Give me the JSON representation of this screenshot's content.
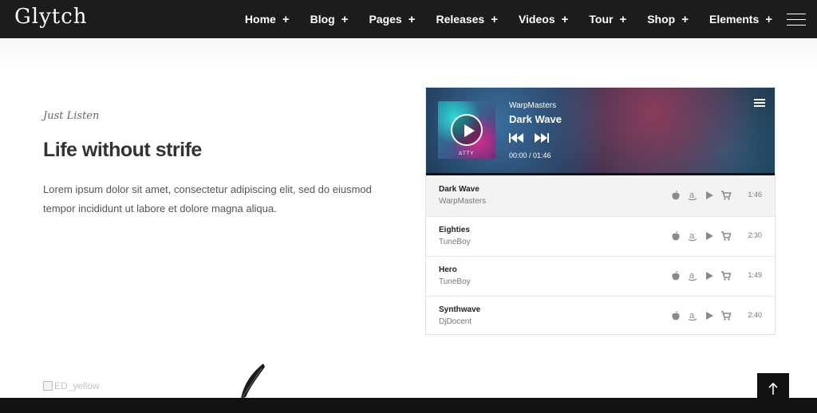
{
  "header": {
    "logo": "Glytch",
    "nav": [
      {
        "label": "Home",
        "plus": "+"
      },
      {
        "label": "Blog",
        "plus": "+"
      },
      {
        "label": "Pages",
        "plus": "+"
      },
      {
        "label": "Releases",
        "plus": "+"
      },
      {
        "label": "Videos",
        "plus": "+"
      },
      {
        "label": "Tour",
        "plus": "+"
      },
      {
        "label": "Shop",
        "plus": "+"
      },
      {
        "label": "Elements",
        "plus": "+"
      }
    ],
    "menu_icon": "hamburger-icon"
  },
  "intro": {
    "eyebrow": "Just Listen",
    "heading": "Life without strife",
    "paragraph": "Lorem ipsum dolor sit amet, consectetur adipiscing elit, sed do eiusmod tempor incididunt ut labore et dolore magna aliqua."
  },
  "player": {
    "artist": "WarpMasters",
    "title": "Dark Wave",
    "time": "00:00 / 01:46",
    "cover_label": "ΔTTY",
    "tracks": [
      {
        "name": "Dark Wave",
        "artist": "WarpMasters",
        "duration": "1:46"
      },
      {
        "name": "Eighties",
        "artist": "TuneBoy",
        "duration": "2:30"
      },
      {
        "name": "Hero",
        "artist": "TuneBoy",
        "duration": "1:49"
      },
      {
        "name": "Synthwave",
        "artist": "DjDocent",
        "duration": "2:40"
      }
    ],
    "store_icons": [
      "apple-icon",
      "amazon-icon",
      "google-play-icon",
      "cart-icon"
    ]
  },
  "footer": {
    "broken_image_alt": "ED_yellow"
  },
  "colors": {
    "header_bg": "#1c1c1c",
    "text_dark": "#333333",
    "muted": "#777777"
  }
}
